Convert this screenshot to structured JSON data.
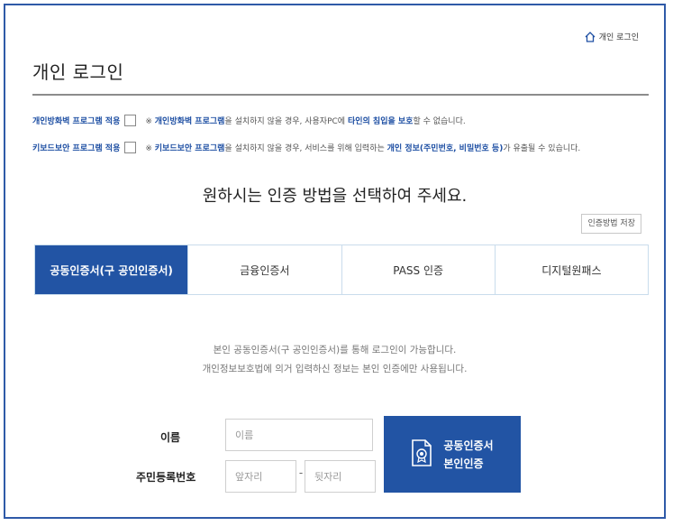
{
  "breadcrumb": {
    "label": "개인 로그인",
    "icon": "home-icon"
  },
  "page": {
    "title": "개인 로그인"
  },
  "options": {
    "firewall": {
      "label": "개인방화벽 프로그램 적용",
      "note_prefix": "※ ",
      "note_highlight": "개인방화벽 프로그램",
      "note_mid": "을 설치하지 않을 경우, 사용자PC에 ",
      "note_highlight2": "타인의 침입을 보호",
      "note_suffix": "할 수 없습니다."
    },
    "keyboard": {
      "label": "키보드보안 프로그램 적용",
      "note_prefix": "※ ",
      "note_highlight": "키보드보안 프로그램",
      "note_mid": "을 설치하지 않을 경우, 서비스를 위해 입력하는 ",
      "note_highlight2": "개인 정보(주민번호, 비밀번호 등)",
      "note_suffix": "가 유출될 수 있습니다."
    }
  },
  "headline": "원하시는 인증 방법을 선택하여 주세요.",
  "save_method_label": "인증방법 저장",
  "tabs": [
    {
      "label": "공동인증서(구 공인인증서)",
      "active": true
    },
    {
      "label": "금융인증서",
      "active": false
    },
    {
      "label": "PASS 인증",
      "active": false
    },
    {
      "label": "디지털원패스",
      "active": false
    }
  ],
  "info": {
    "line1": "본인 공동인증서(구 공인인증서)를 통해 로그인이 가능합니다.",
    "line2": "개인정보보호법에 의거 입력하신 정보는 본인 인증에만 사용됩니다."
  },
  "form": {
    "name_label": "이름",
    "name_placeholder": "이름",
    "rrn_label": "주민등록번호",
    "rrn_front_placeholder": "앞자리",
    "rrn_separator": "-",
    "rrn_back_placeholder": "뒷자리"
  },
  "cert_button": {
    "line1": "공동인증서",
    "line2": "본인인증",
    "icon": "certificate-document-icon"
  },
  "colors": {
    "accent": "#2254a4",
    "highlight_text": "#1e4fa3",
    "border": "#2f5aa8"
  }
}
